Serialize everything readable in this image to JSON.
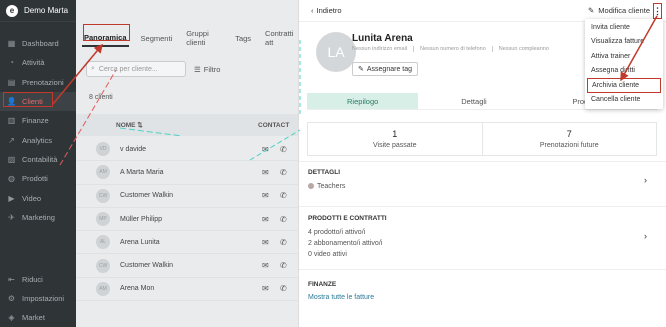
{
  "sidebar": {
    "brand_logo": "e",
    "brand_name": "Demo Marta",
    "items": [
      {
        "label": "Dashboard",
        "icon": "▦"
      },
      {
        "label": "Attività",
        "icon": "◔"
      },
      {
        "label": "Prenotazioni",
        "icon": "▤"
      },
      {
        "label": "Clienti",
        "icon": "👤"
      },
      {
        "label": "Finanze",
        "icon": "▥"
      },
      {
        "label": "Analytics",
        "icon": "↗"
      },
      {
        "label": "Contabilità",
        "icon": "▨"
      },
      {
        "label": "Prodotti",
        "icon": "◍"
      },
      {
        "label": "Video",
        "icon": "▶"
      },
      {
        "label": "Marketing",
        "icon": "✈"
      }
    ],
    "bottom_items": [
      {
        "label": "Riduci",
        "icon": "⇤"
      },
      {
        "label": "Impostazioni",
        "icon": "⚙"
      },
      {
        "label": "Market",
        "icon": "◈"
      }
    ]
  },
  "list": {
    "tabs": [
      "Panoramica",
      "Segmenti",
      "Gruppi clienti",
      "Tags",
      "Contratti att"
    ],
    "search_placeholder": "Cerca per cliente...",
    "filter_label": "Filtro",
    "count": "8 clienti",
    "col_name": "NOME ⇅",
    "col_contact": "CONTACT",
    "rows": [
      {
        "initials": "VD",
        "name": "v davide"
      },
      {
        "initials": "AM",
        "name": "A Marta Maria"
      },
      {
        "initials": "CW",
        "name": "Customer Walkin"
      },
      {
        "initials": "MP",
        "name": "Müller Philipp"
      },
      {
        "initials": "AL",
        "name": "Arena Lunita"
      },
      {
        "initials": "CW",
        "name": "Customer Walkin"
      },
      {
        "initials": "AM",
        "name": "Arena Mon"
      }
    ]
  },
  "detail": {
    "back_label": "Indietro",
    "edit_label": "Modifica cliente",
    "kebab": "⋮",
    "avatar_initials": "LA",
    "client_name": "Lunita Arena",
    "meta": [
      "Nessun indirizzo email",
      "Nessun numero di telefono",
      "Nessun compleanno"
    ],
    "tag_button": "Assegnare tag",
    "tabs": [
      "Riepilogo",
      "Dettagli",
      "Prodotti"
    ],
    "stats": [
      {
        "value": "1",
        "label": "Visite passate"
      },
      {
        "value": "7",
        "label": "Prenotazioni future"
      }
    ],
    "dettagli_title": "DETTAGLI",
    "dettagli_value": "Teachers",
    "prodotti_title": "PRODOTTI E CONTRATTI",
    "prodotti_lines": [
      "4 prodotto/i attivo/i",
      "2 abbonamento/i attivo/i",
      "0 video attivi"
    ],
    "finanze_title": "FINANZE",
    "finanze_link": "Mostra tutte le fatture"
  },
  "menu": {
    "items": [
      "Invita cliente",
      "Visualizza fatture",
      "Attiva trainer",
      "Assegna diritti",
      "Archivia cliente",
      "Cancella cliente"
    ]
  },
  "colors": {
    "sidebar_bg": "#2f3437",
    "accent_red": "#c0392b",
    "active_tab_bg": "#d8efe8",
    "link": "#2a7a9a"
  }
}
